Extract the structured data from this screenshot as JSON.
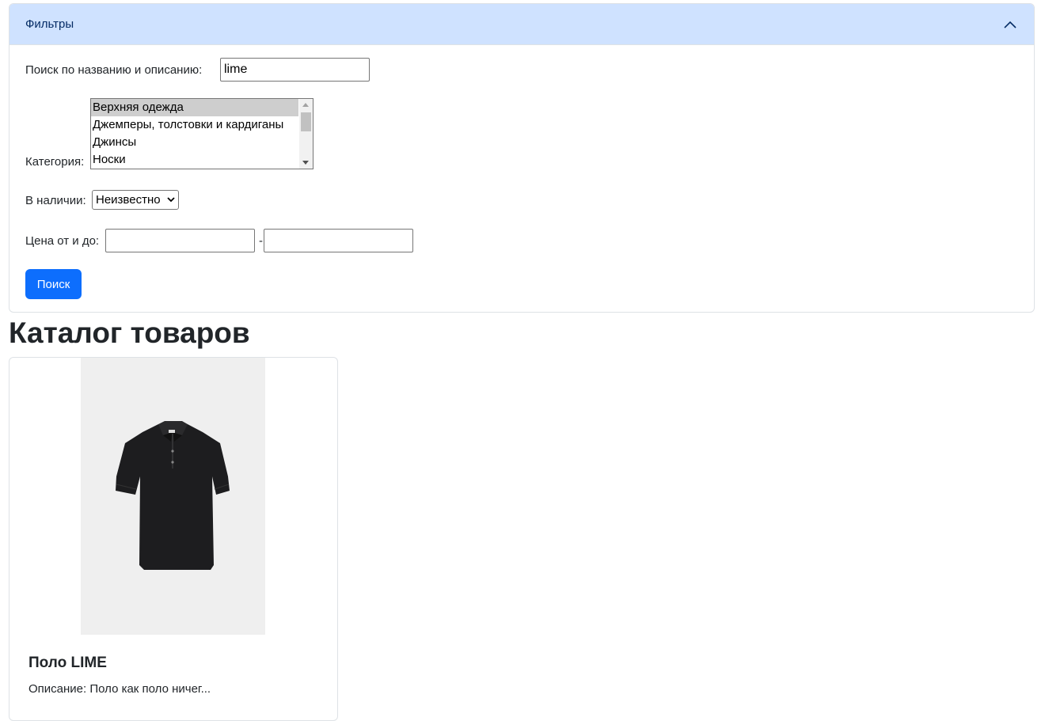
{
  "filters": {
    "header_title": "Фильтры",
    "search_label": "Поиск по названию и описанию:",
    "search_value": "lime",
    "category_label": "Категория:",
    "categories": [
      {
        "label": "Верхняя одежда",
        "selected": true
      },
      {
        "label": "Джемперы, толстовки и кардиганы",
        "selected": false
      },
      {
        "label": "Джинсы",
        "selected": false
      },
      {
        "label": "Носки",
        "selected": false
      }
    ],
    "stock_label": "В наличии:",
    "stock_value": "Неизвестно",
    "price_label": "Цена от и до:",
    "price_separator": "-",
    "price_from": "",
    "price_to": "",
    "search_button": "Поиск"
  },
  "catalog": {
    "title": "Каталог товаров",
    "products": [
      {
        "name": "Поло LIME",
        "description": "Описание: Поло как поло ничег..."
      }
    ]
  },
  "colors": {
    "accent": "#0d6efd",
    "header_bg": "#cfe2ff"
  }
}
